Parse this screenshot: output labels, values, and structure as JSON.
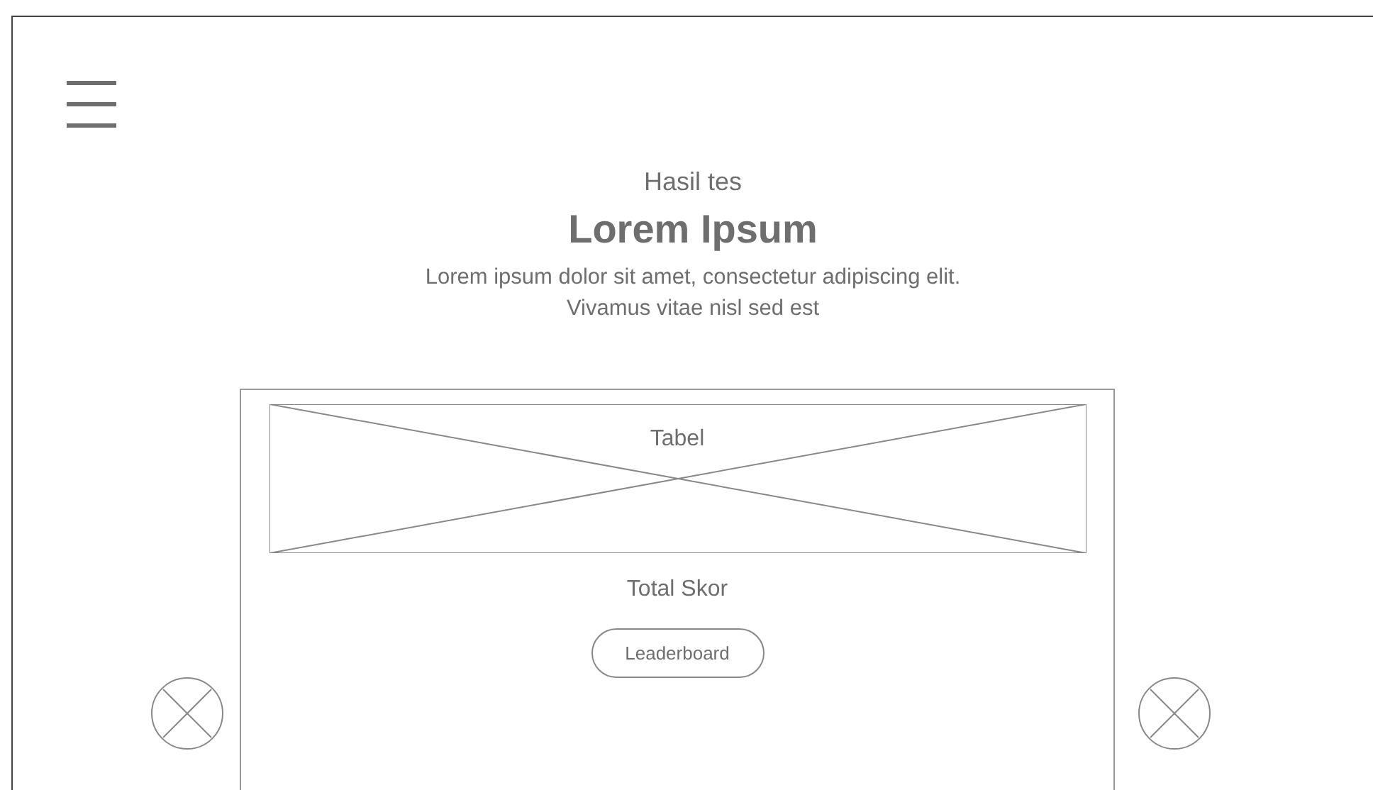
{
  "header": {
    "subtitle": "Hasil tes",
    "title": "Lorem Ipsum",
    "description": "Lorem ipsum dolor sit amet, consectetur adipiscing elit.\nVivamus vitae nisl sed est"
  },
  "card": {
    "placeholder_label": "Tabel",
    "total_label": "Total Skor",
    "button": "Leaderboard"
  }
}
